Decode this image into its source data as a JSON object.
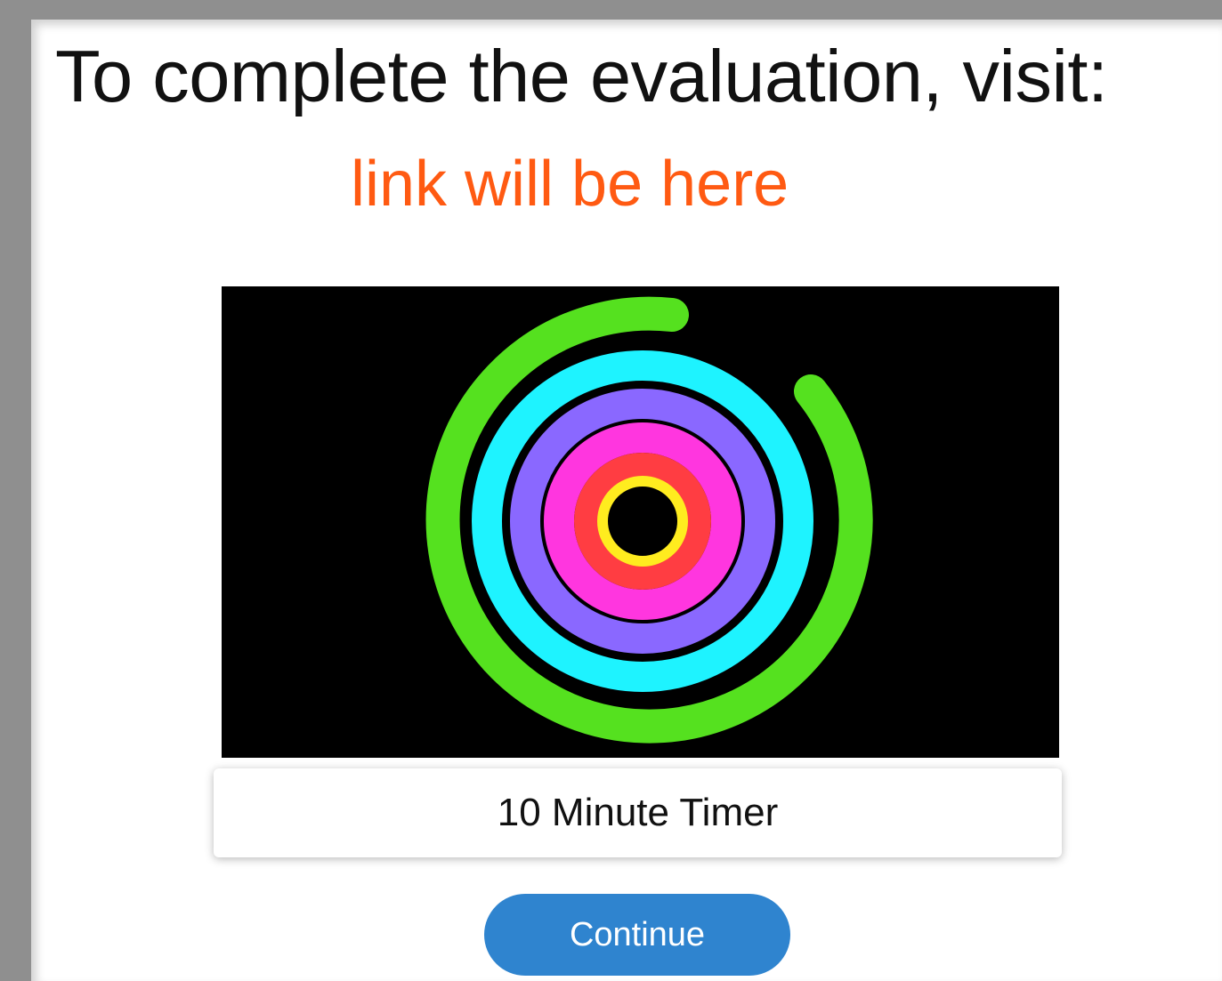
{
  "heading": "To complete the evaluation, visit:",
  "link_placeholder": "link will be here",
  "video": {
    "caption": "10 Minute Timer",
    "icon": "timer-rings-icon"
  },
  "actions": {
    "continue_label": "Continue"
  },
  "colors": {
    "heading": "#111111",
    "link": "#ff5a12",
    "button": "#2f84cf",
    "video_bg": "#000000",
    "ring_green": "#55e11f",
    "ring_cyan": "#1ef3ff",
    "ring_purple": "#8a68ff",
    "ring_pink": "#ff36df",
    "ring_red": "#ff3d42",
    "ring_yellow": "#ffec1f"
  }
}
